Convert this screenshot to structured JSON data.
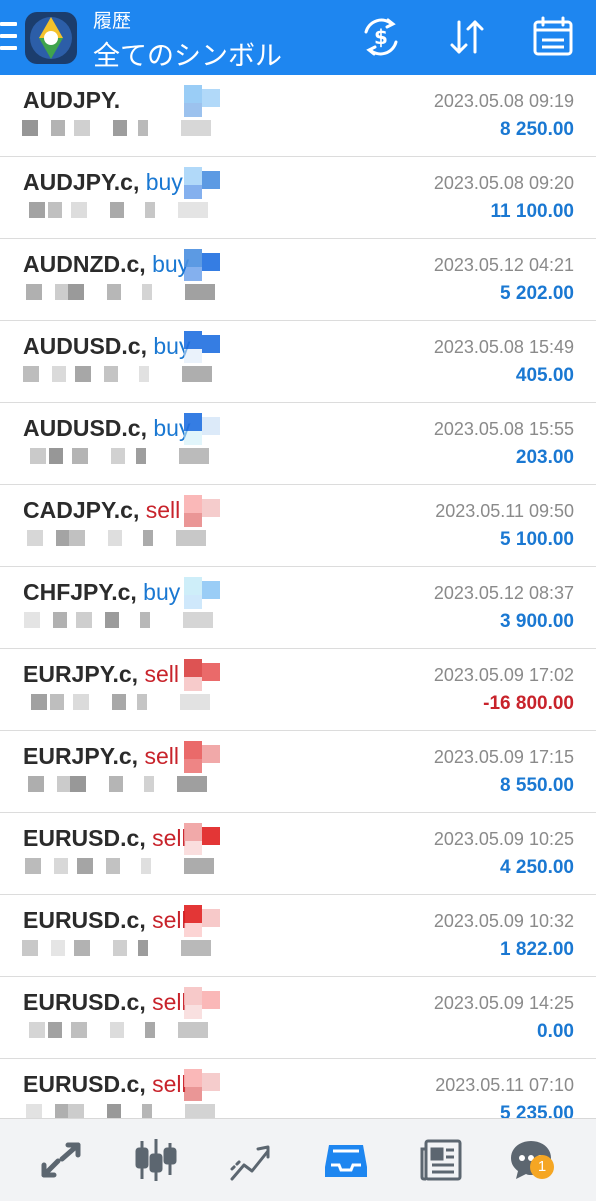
{
  "header": {
    "subtitle": "履歴",
    "title": "全てのシンボル",
    "icons": [
      "menu-icon",
      "app-logo",
      "dollar-exchange-icon",
      "sort-icon",
      "calendar-icon"
    ],
    "accent": "#1e86f0"
  },
  "colors": {
    "buy": "#1a78d2",
    "sell": "#c8232b",
    "positive": "#1a78d2",
    "negative": "#c8232b"
  },
  "trades": [
    {
      "symbol": "AUDJPY.",
      "type": "",
      "sep": "",
      "date": "2023.05.08 09:19",
      "profit": "8 250.00"
    },
    {
      "symbol": "AUDJPY.c",
      "type": "buy",
      "sep": ", ",
      "date": "2023.05.08 09:20",
      "profit": "11 100.00"
    },
    {
      "symbol": "AUDNZD.c",
      "type": "buy",
      "sep": ", ",
      "date": "2023.05.12 04:21",
      "profit": "5 202.00"
    },
    {
      "symbol": "AUDUSD.c",
      "type": "buy",
      "sep": ", ",
      "date": "2023.05.08 15:49",
      "profit": "405.00"
    },
    {
      "symbol": "AUDUSD.c",
      "type": "buy",
      "sep": ", ",
      "date": "2023.05.08 15:55",
      "profit": "203.00"
    },
    {
      "symbol": "CADJPY.c",
      "type": "sell",
      "sep": ", ",
      "date": "2023.05.11 09:50",
      "profit": "5 100.00"
    },
    {
      "symbol": "CHFJPY.c",
      "type": "buy",
      "sep": ", ",
      "date": "2023.05.12 08:37",
      "profit": "3 900.00"
    },
    {
      "symbol": "EURJPY.c",
      "type": "sell",
      "sep": ", ",
      "date": "2023.05.09 17:02",
      "profit": "-16 800.00"
    },
    {
      "symbol": "EURJPY.c",
      "type": "sell",
      "sep": ", ",
      "date": "2023.05.09 17:15",
      "profit": "8 550.00"
    },
    {
      "symbol": "EURUSD.c",
      "type": "sell",
      "sep": ", ",
      "date": "2023.05.09 10:25",
      "profit": "4 250.00"
    },
    {
      "symbol": "EURUSD.c",
      "type": "sell",
      "sep": ", ",
      "date": "2023.05.09 10:32",
      "profit": "1 822.00"
    },
    {
      "symbol": "EURUSD.c",
      "type": "sell",
      "sep": ", ",
      "date": "2023.05.09 14:25",
      "profit": "0.00"
    },
    {
      "symbol": "EURUSD.c",
      "type": "sell",
      "sep": ", ",
      "date": "2023.05.11 07:10",
      "profit": "5 235.00"
    }
  ],
  "bottom_nav": {
    "items": [
      "quotes-arrows-icon",
      "chart-candles-icon",
      "trade-icon",
      "history-inbox-icon",
      "news-icon",
      "chat-icon"
    ],
    "active": "history-inbox-icon",
    "badge": "1"
  }
}
